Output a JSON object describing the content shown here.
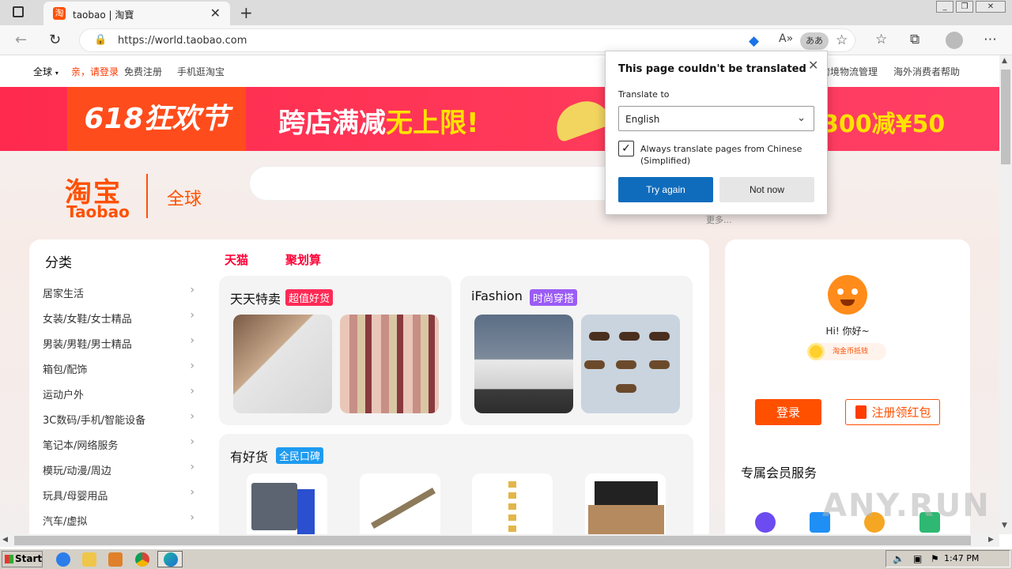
{
  "browser": {
    "tab_title": "taobao | 淘寶",
    "tab_favicon": "淘",
    "url": "https://world.taobao.com",
    "translate_pill": "ああ"
  },
  "topnav": {
    "global": "全球",
    "login": "亲，请登录",
    "register": "免费注册",
    "mobile": "手机逛淘宝",
    "logistics": "跨境物流管理",
    "help": "海外消费者帮助"
  },
  "banner": {
    "festival": "618狂欢节",
    "main_text": "跨店满减",
    "main_highlight": "无上限!",
    "right_text": "300减¥50"
  },
  "logo": {
    "cn": "淘宝",
    "en": "Taobao",
    "global": "全球"
  },
  "search": {
    "more": "更多..."
  },
  "categories": {
    "title": "分类",
    "tmall": "天猫",
    "juhuasuan": "聚划算",
    "items": [
      "居家生活",
      "女装/女鞋/女士精品",
      "男装/男鞋/男士精品",
      "箱包/配饰",
      "运动户外",
      "3C数码/手机/智能设备",
      "笔记本/网络服务",
      "模玩/动漫/周边",
      "玩具/母婴用品",
      "汽车/虚拟"
    ]
  },
  "panels": {
    "daily": {
      "title": "天天特卖",
      "tag": "超值好货",
      "tag_color": "#ff2a55"
    },
    "ifashion": {
      "title": "iFashion",
      "tag": "时尚穿搭",
      "tag_color": "#9b5cf6"
    },
    "good": {
      "title": "有好货",
      "tag": "全民口碑",
      "tag_color": "#1e9bf0"
    }
  },
  "user": {
    "greeting": "Hi! 你好~",
    "coin": "淘金币抵钱",
    "login_btn": "登录",
    "register_btn": "注册领红包",
    "vip_title": "专属会员服务"
  },
  "translate_popup": {
    "title": "This page couldn't be translated",
    "translate_to_label": "Translate to",
    "language": "English",
    "always_label": "Always translate pages from Chinese (Simplified)",
    "always_checked": true,
    "try_again": "Try again",
    "not_now": "Not now"
  },
  "taskbar": {
    "start": "Start",
    "clock": "1:47 PM"
  },
  "watermark": "ANY.RUN"
}
